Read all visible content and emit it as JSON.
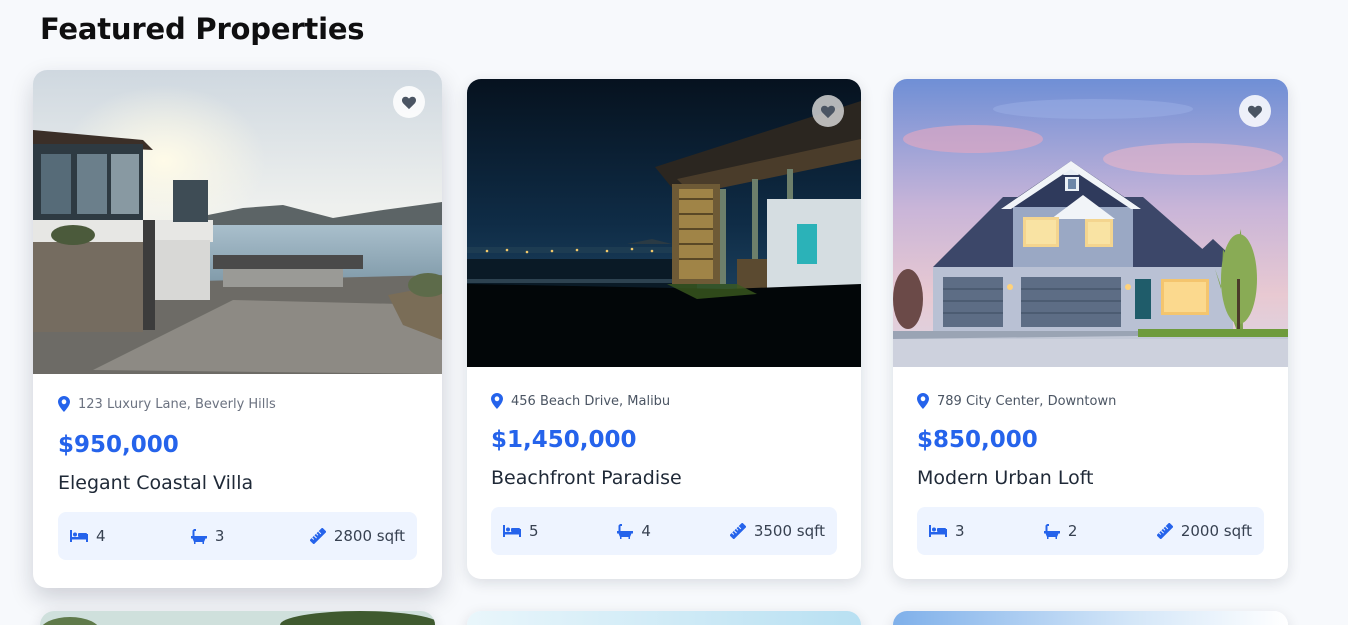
{
  "section": {
    "title": "Featured Properties"
  },
  "colors": {
    "accent": "#2563eb",
    "feature_bg": "#eef4ff",
    "page_bg": "#f7f9fc"
  },
  "properties": [
    {
      "address": "123 Luxury Lane, Beverly Hills",
      "price": "$950,000",
      "name": "Elegant Coastal Villa",
      "beds": "4",
      "baths": "3",
      "area": "2800 sqft",
      "favorite_icon": "heart-icon"
    },
    {
      "address": "456 Beach Drive, Malibu",
      "price": "$1,450,000",
      "name": "Beachfront Paradise",
      "beds": "5",
      "baths": "4",
      "area": "3500 sqft",
      "favorite_icon": "heart-icon"
    },
    {
      "address": "789 City Center, Downtown",
      "price": "$850,000",
      "name": "Modern Urban Loft",
      "beds": "3",
      "baths": "2",
      "area": "2000 sqft",
      "favorite_icon": "heart-icon"
    }
  ]
}
